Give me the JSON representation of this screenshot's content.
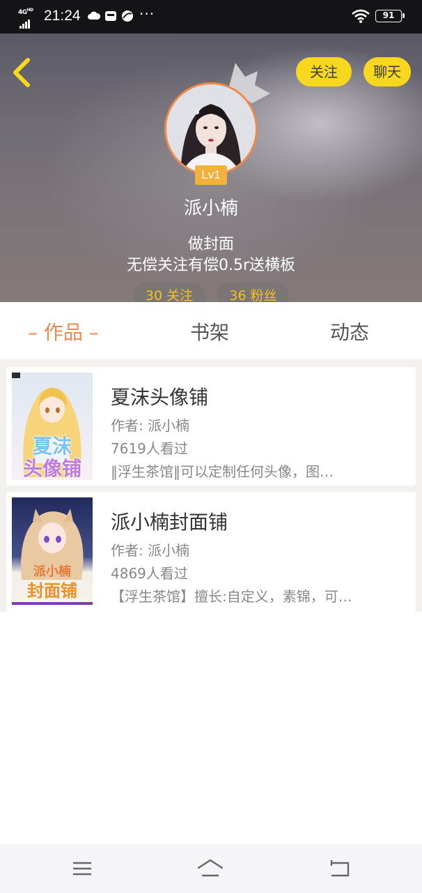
{
  "status_bar": {
    "network": "4G HD",
    "time": "21:24",
    "more": "···",
    "battery": "91"
  },
  "header": {
    "follow_label": "关注",
    "chat_label": "聊天",
    "level": "Lv1",
    "username": "派小楠",
    "bio_line1": "做封面",
    "bio_line2": "无偿关注有偿0.5r送横板",
    "following": "30 关注",
    "fans": "36 粉丝"
  },
  "tabs": [
    {
      "label": "– 作品 –",
      "active": true
    },
    {
      "label": "书架",
      "active": false
    },
    {
      "label": "动态",
      "active": false
    }
  ],
  "works": [
    {
      "title": "夏沫头像铺",
      "author": "作者: 派小楠",
      "views": "7619人看过",
      "desc": "‖浮生茶馆‖可以定制任何头像，图…",
      "cover_text1": "夏沫",
      "cover_text2": "头像铺"
    },
    {
      "title": "派小楠封面铺",
      "author": "作者: 派小楠",
      "views": "4869人看过",
      "desc": "【浮生茶馆】擅长:自定义，素锦，可…",
      "cover_text1": "派小楠",
      "cover_text2": "封面铺"
    }
  ],
  "colors": {
    "accent_orange": "#f0884a",
    "button_yellow": "#f8d81f",
    "level_orange": "#f1b13a",
    "stat_yellow": "#f5c21d"
  },
  "icons": {
    "back": "chevron-left-icon",
    "menu": "menu-icon",
    "home": "home-icon",
    "back_nav": "return-icon"
  }
}
